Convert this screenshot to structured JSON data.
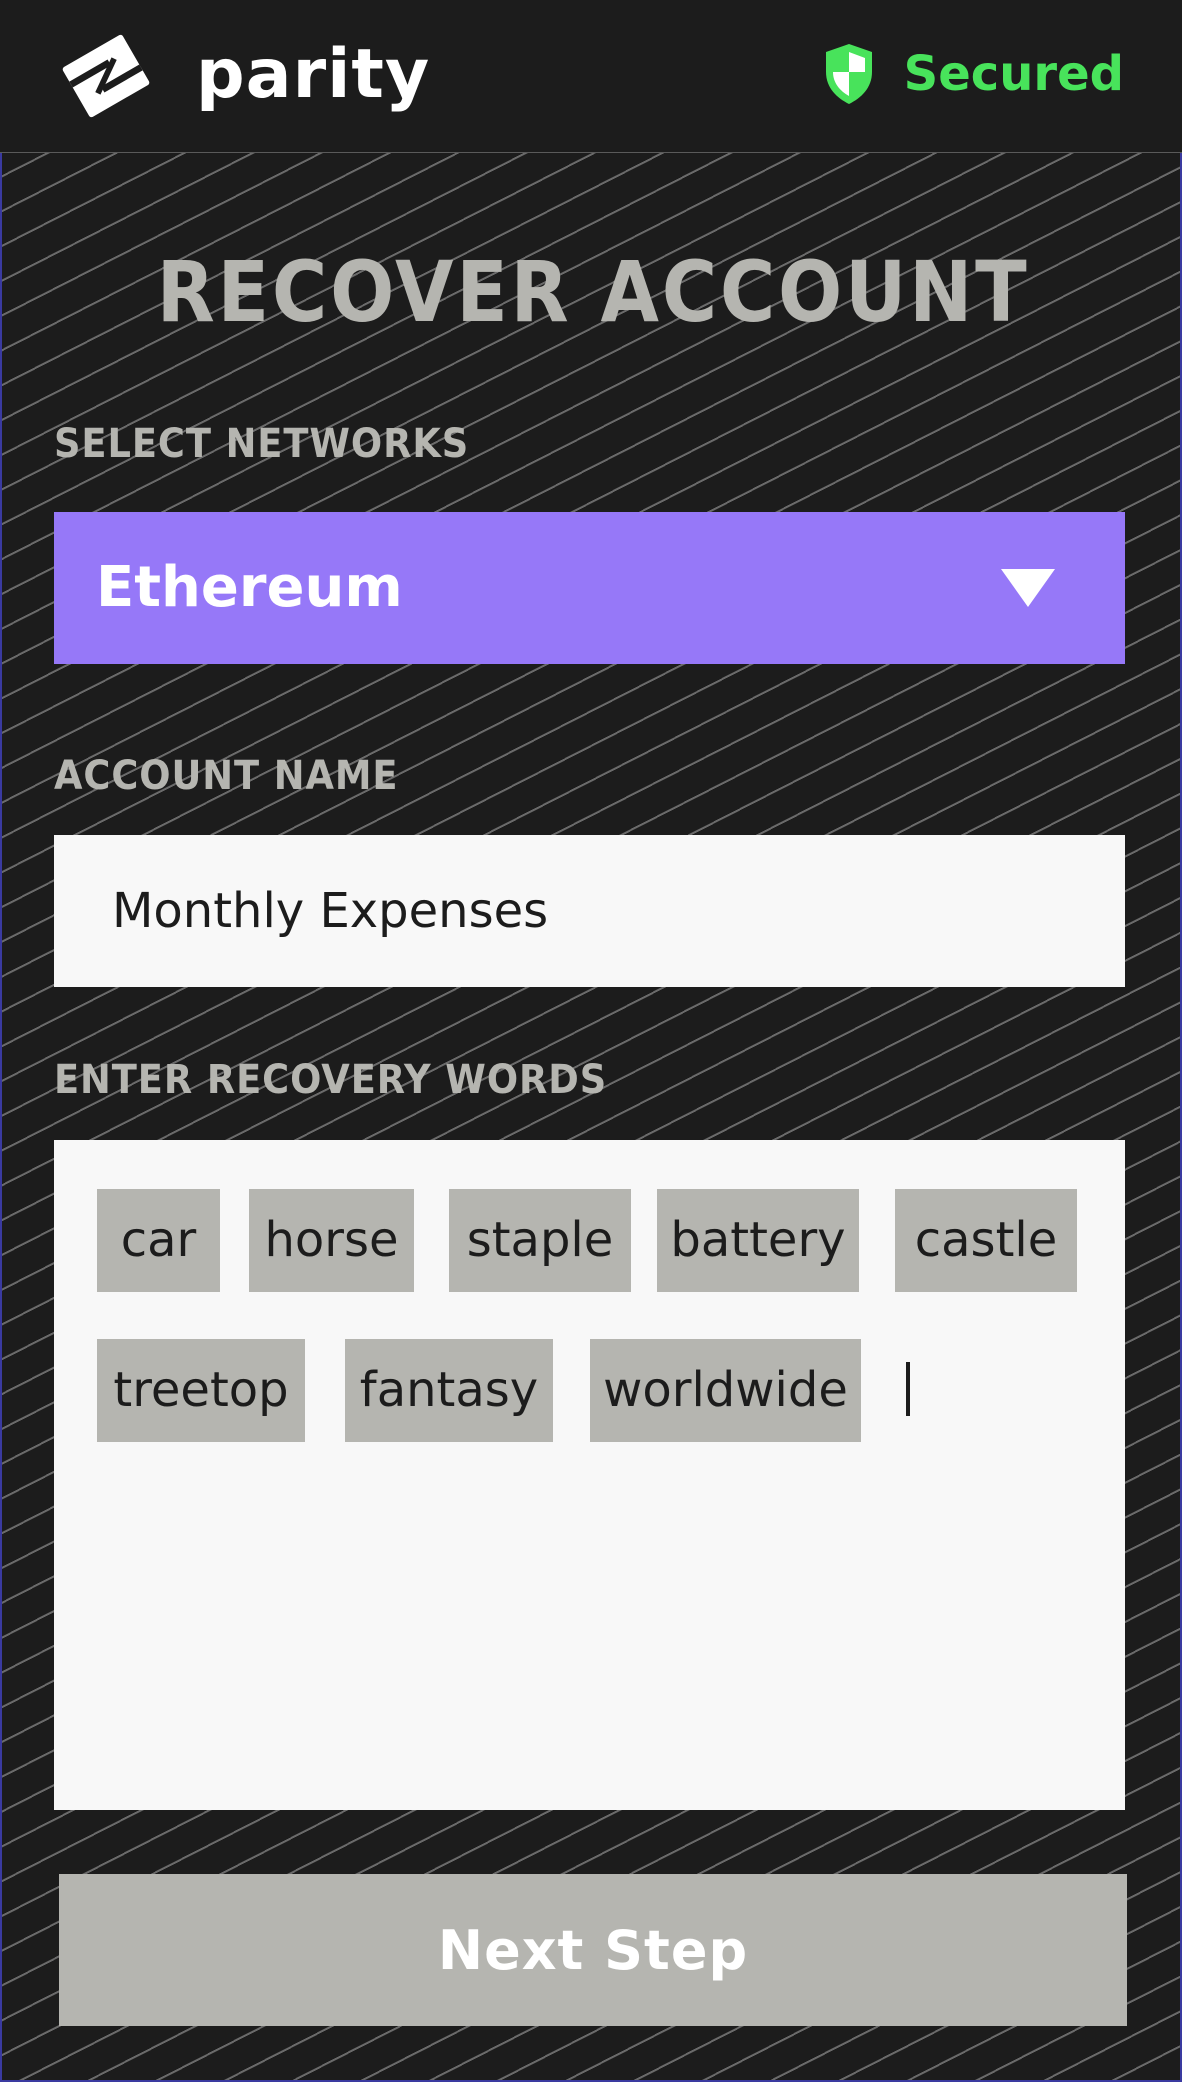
{
  "header": {
    "brand": "parity",
    "status": "Secured",
    "status_color": "#48e35b",
    "brand_icon": "parity-logo-icon",
    "status_icon": "shield-icon"
  },
  "page": {
    "title": "RECOVER ACCOUNT"
  },
  "networks": {
    "label": "SELECT NETWORKS",
    "selected": "Ethereum",
    "accent_color": "#9678f8",
    "dropdown_icon": "chevron-down-icon"
  },
  "account_name": {
    "label": "ACCOUNT NAME",
    "value": "Monthly Expenses"
  },
  "recovery": {
    "label": "ENTER RECOVERY WORDS",
    "words": [
      "car",
      "horse",
      "staple",
      "battery",
      "castle",
      "treetop",
      "fantasy",
      "worldwide"
    ]
  },
  "actions": {
    "next_label": "Next Step"
  }
}
